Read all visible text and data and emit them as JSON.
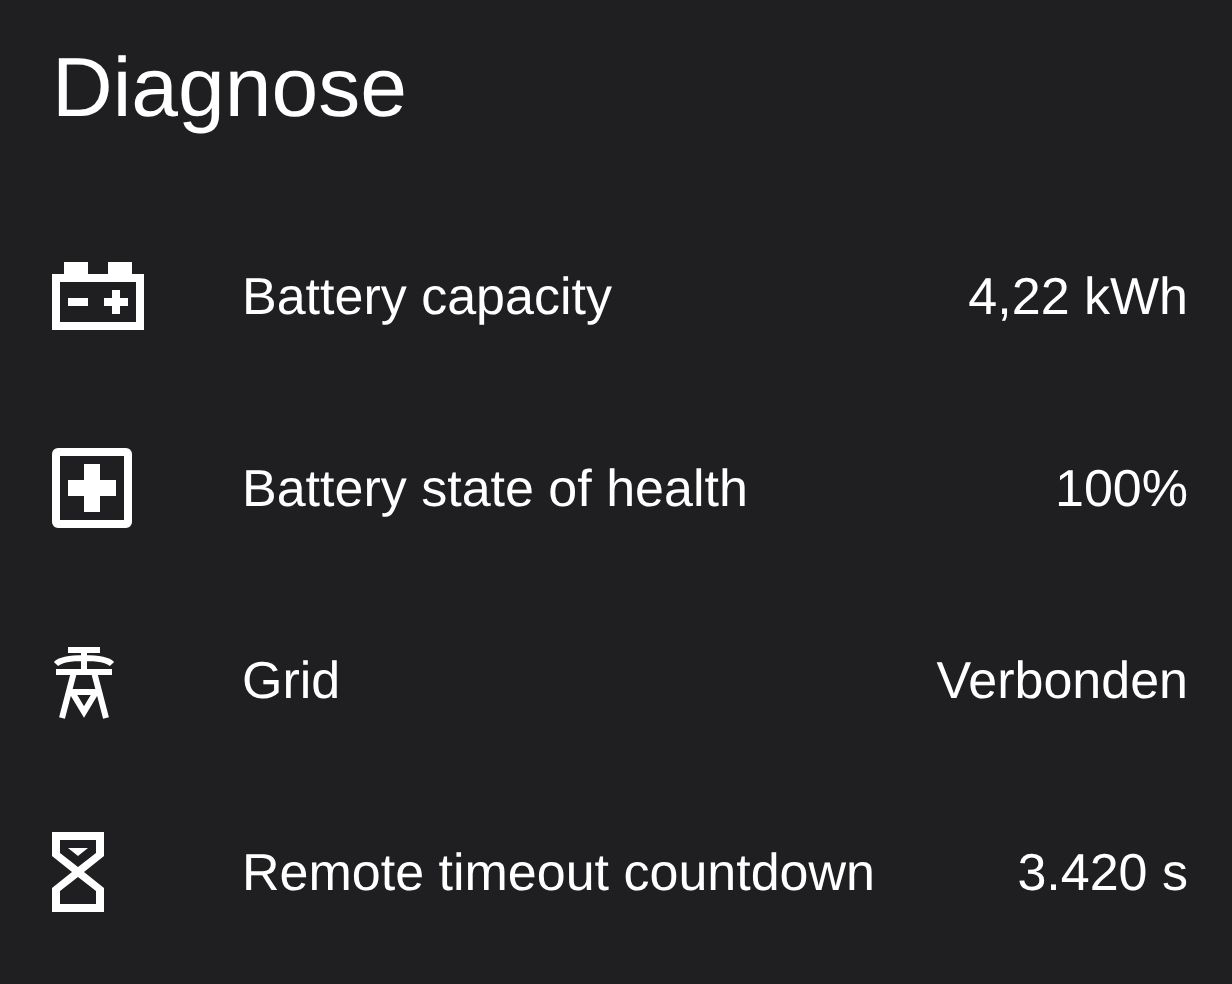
{
  "title": "Diagnose",
  "rows": [
    {
      "kind": "battery",
      "label": "Battery capacity",
      "value": "4,22 kWh"
    },
    {
      "kind": "health",
      "label": "Battery state of health",
      "value": "100%"
    },
    {
      "kind": "grid",
      "label": "Grid",
      "value": "Verbonden"
    },
    {
      "kind": "timer",
      "label": "Remote timeout countdown",
      "value": "3.420 s"
    }
  ]
}
